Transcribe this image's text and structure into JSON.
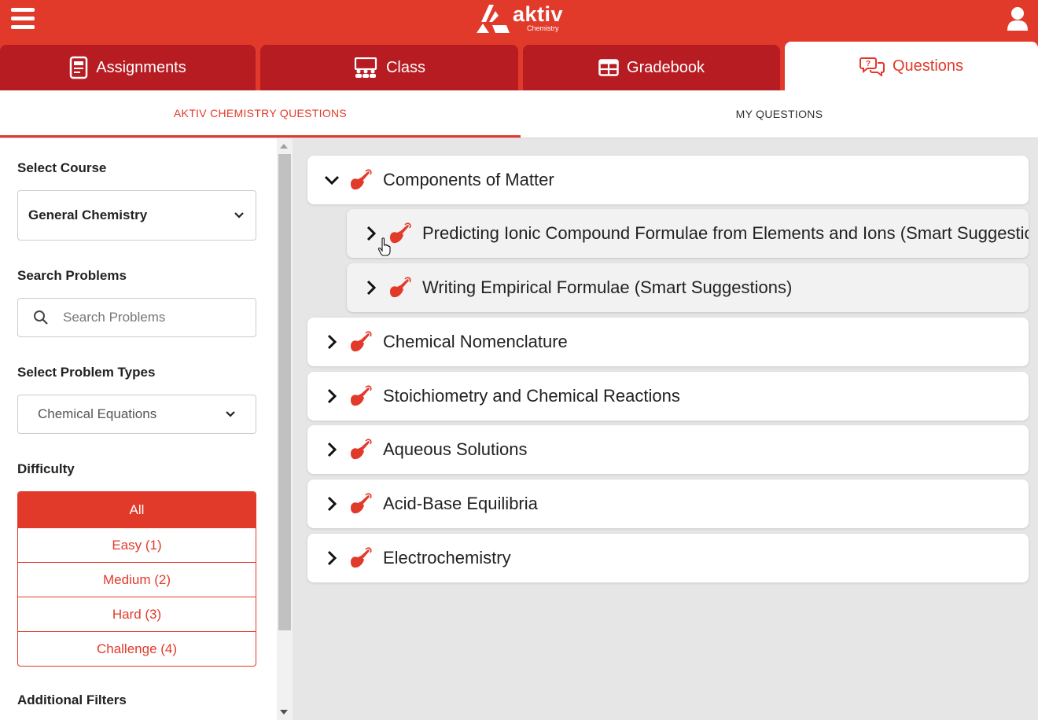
{
  "brand": {
    "name": "aktiv",
    "subtitle": "Chemistry",
    "accent": "#e23a2a",
    "tab_dark": "#b71c23"
  },
  "header": {
    "menu_icon": "hamburger-icon",
    "user_icon": "user-icon"
  },
  "nav_tabs": [
    {
      "label": "Assignments",
      "icon": "assignment-icon"
    },
    {
      "label": "Class",
      "icon": "class-icon"
    },
    {
      "label": "Gradebook",
      "icon": "gradebook-icon"
    },
    {
      "label": "Questions",
      "icon": "questions-icon",
      "active": true
    }
  ],
  "sub_tabs": [
    {
      "label": "AKTIV CHEMISTRY QUESTIONS",
      "active": true
    },
    {
      "label": "MY QUESTIONS"
    }
  ],
  "sidebar": {
    "course_label": "Select Course",
    "course_value": "General Chemistry",
    "search_label": "Search Problems",
    "search_placeholder": "Search Problems",
    "types_label": "Select Problem Types",
    "types_value": "Chemical Equations",
    "difficulty_label": "Difficulty",
    "difficulty_options": [
      "All",
      "Easy (1)",
      "Medium (2)",
      "Hard (3)",
      "Challenge (4)"
    ],
    "difficulty_selected": "All",
    "additional_label": "Additional Filters"
  },
  "topics": [
    {
      "label": "Components of Matter",
      "expanded": true,
      "children": [
        {
          "label": "Predicting Ionic Compound Formulae from Elements and Ions (Smart Suggestions)"
        },
        {
          "label": "Writing Empirical Formulae (Smart Suggestions)"
        }
      ]
    },
    {
      "label": "Chemical Nomenclature"
    },
    {
      "label": "Stoichiometry and Chemical Reactions"
    },
    {
      "label": "Aqueous Solutions"
    },
    {
      "label": "Acid-Base Equilibria"
    },
    {
      "label": "Electrochemistry"
    }
  ]
}
